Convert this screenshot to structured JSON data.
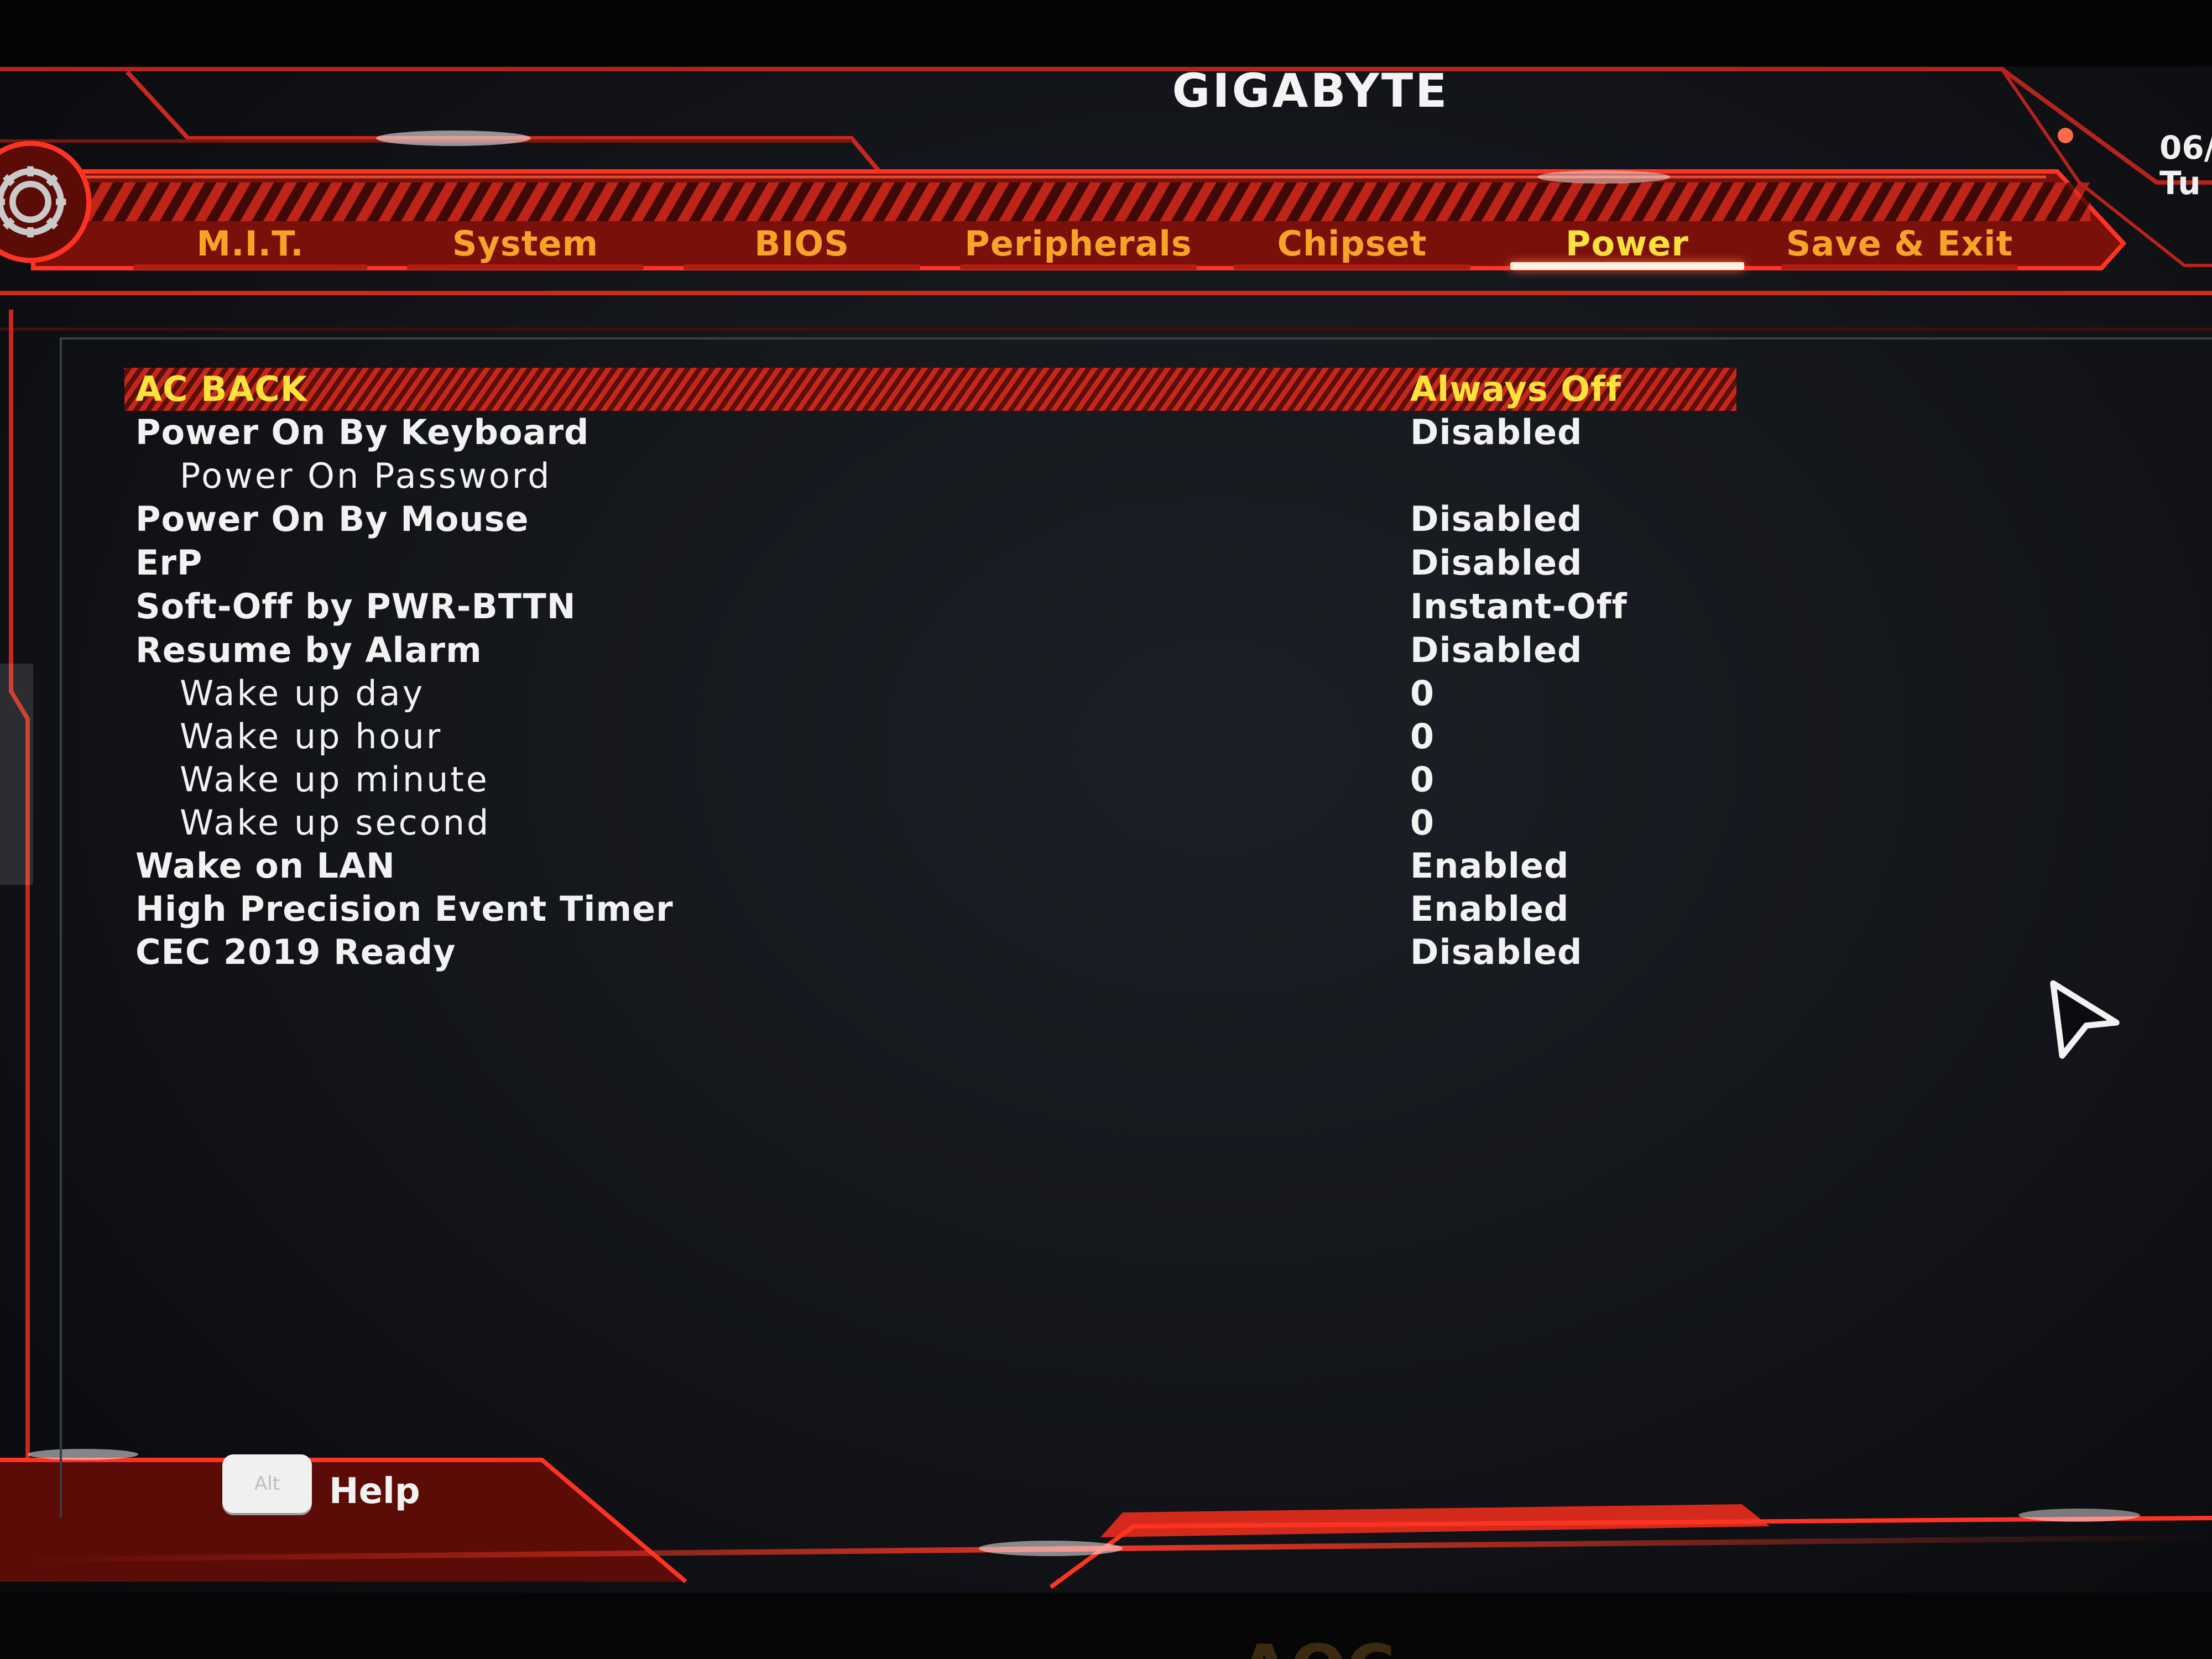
{
  "brand": "GIGABYTE",
  "datetime": {
    "date": "06/",
    "day": "Tu"
  },
  "tabs": [
    {
      "label": "M.I.T.",
      "active": false
    },
    {
      "label": "System",
      "active": false
    },
    {
      "label": "BIOS",
      "active": false
    },
    {
      "label": "Peripherals",
      "active": false
    },
    {
      "label": "Chipset",
      "active": false
    },
    {
      "label": "Power",
      "active": true
    },
    {
      "label": "Save & Exit",
      "active": false
    }
  ],
  "settings": [
    {
      "label": "AC BACK",
      "value": "Always Off",
      "selected": true,
      "sub": false
    },
    {
      "label": "Power On By Keyboard",
      "value": "Disabled",
      "selected": false,
      "sub": false
    },
    {
      "label": "Power On Password",
      "value": "",
      "selected": false,
      "sub": true
    },
    {
      "label": "Power On By Mouse",
      "value": "Disabled",
      "selected": false,
      "sub": false
    },
    {
      "label": "ErP",
      "value": "Disabled",
      "selected": false,
      "sub": false
    },
    {
      "label": "Soft-Off by PWR-BTTN",
      "value": "Instant-Off",
      "selected": false,
      "sub": false
    },
    {
      "label": "Resume by Alarm",
      "value": "Disabled",
      "selected": false,
      "sub": false
    },
    {
      "label": "Wake up day",
      "value": "0",
      "selected": false,
      "sub": true
    },
    {
      "label": "Wake up hour",
      "value": "0",
      "selected": false,
      "sub": true
    },
    {
      "label": "Wake up minute",
      "value": "0",
      "selected": false,
      "sub": true
    },
    {
      "label": "Wake up second",
      "value": "0",
      "selected": false,
      "sub": true
    },
    {
      "label": "Wake on LAN",
      "value": "Enabled",
      "selected": false,
      "sub": false
    },
    {
      "label": "High Precision Event Timer",
      "value": "Enabled",
      "selected": false,
      "sub": false
    },
    {
      "label": "CEC 2019 Ready",
      "value": "Disabled",
      "selected": false,
      "sub": false
    }
  ],
  "footer": {
    "key_label": "Alt",
    "help_label": "Help"
  },
  "monitor_brand": "AOC",
  "colors": {
    "accent_red": "#d42a1c",
    "tab_text": "#f6a428",
    "active_tab_text": "#ffe23a",
    "selected_text": "#ffe23a",
    "item_text": "#f2f2f2"
  },
  "icons": {
    "settings": "gear-icon",
    "pointer": "mouse-cursor-icon"
  }
}
